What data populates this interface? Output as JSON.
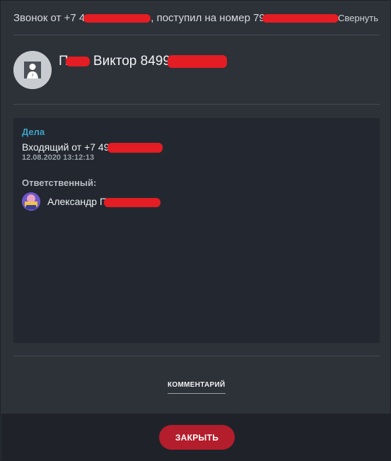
{
  "header": {
    "call_prefix": "Звонок от +7 4",
    "call_middle": ", поступил на номер 79",
    "collapse_label": "Свернуть"
  },
  "contact": {
    "name_prefix": "П",
    "name_middle": " Виктор 8499"
  },
  "activity": {
    "section_title": "Дела",
    "deal_title": "Входящий от +7 49",
    "deal_datetime": "12.08.2020 13:12:13",
    "responsible_label": "Ответственный:",
    "responsible_name": "Александр П"
  },
  "comment_label": "КОММЕНТАРИЙ",
  "footer": {
    "close_label": "ЗАКРЫТЬ"
  },
  "colors": {
    "accent_blue": "#3ea3c9",
    "close_button": "#b41d2c",
    "redaction": "#e31d23"
  }
}
